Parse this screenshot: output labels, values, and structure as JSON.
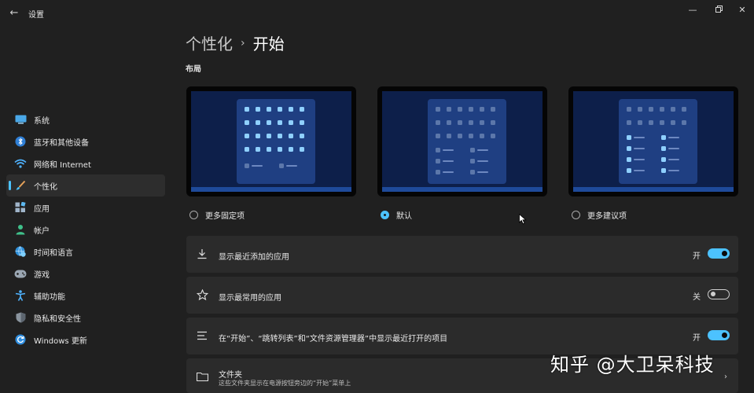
{
  "window": {
    "title": "设置",
    "back_icon": "back-arrow-icon",
    "controls": [
      "minimize-icon",
      "restore-icon",
      "close-icon"
    ]
  },
  "sidebar": {
    "items": [
      {
        "label": "系统",
        "icon": "system-monitor-icon",
        "active": false
      },
      {
        "label": "蓝牙和其他设备",
        "icon": "bluetooth-icon",
        "active": false
      },
      {
        "label": "网络和 Internet",
        "icon": "wifi-icon",
        "active": false
      },
      {
        "label": "个性化",
        "icon": "brush-icon",
        "active": true
      },
      {
        "label": "应用",
        "icon": "apps-icon",
        "active": false
      },
      {
        "label": "帐户",
        "icon": "person-icon",
        "active": false
      },
      {
        "label": "时间和语言",
        "icon": "globe-clock-icon",
        "active": false
      },
      {
        "label": "游戏",
        "icon": "gamepad-icon",
        "active": false
      },
      {
        "label": "辅助功能",
        "icon": "accessibility-icon",
        "active": false
      },
      {
        "label": "隐私和安全性",
        "icon": "shield-icon",
        "active": false
      },
      {
        "label": "Windows 更新",
        "icon": "update-icon",
        "active": false
      }
    ]
  },
  "header": {
    "parent": "个性化",
    "separator": "›",
    "current": "开始"
  },
  "layout": {
    "section_label": "布局",
    "options": [
      {
        "label": "更多固定项",
        "selected": false
      },
      {
        "label": "默认",
        "selected": true
      },
      {
        "label": "更多建议项",
        "selected": false
      }
    ]
  },
  "settings": [
    {
      "label": "显示最近添加的应用",
      "icon": "download-icon",
      "state": "开",
      "on": true
    },
    {
      "label": "显示最常用的应用",
      "icon": "star-icon",
      "state": "关",
      "on": false
    },
    {
      "label": "在“开始”、“跳转列表”和“文件资源管理器”中显示最近打开的项目",
      "icon": "list-icon",
      "state": "开",
      "on": true
    }
  ],
  "folders": {
    "title": "文件夹",
    "description": "这些文件夹显示在电源按钮旁边的“开始”菜单上",
    "icon": "folder-icon"
  },
  "watermark": "知乎 @大卫呆科技",
  "colors": {
    "accent": "#4cc2ff",
    "background": "#202020",
    "card": "#2b2b2b"
  }
}
